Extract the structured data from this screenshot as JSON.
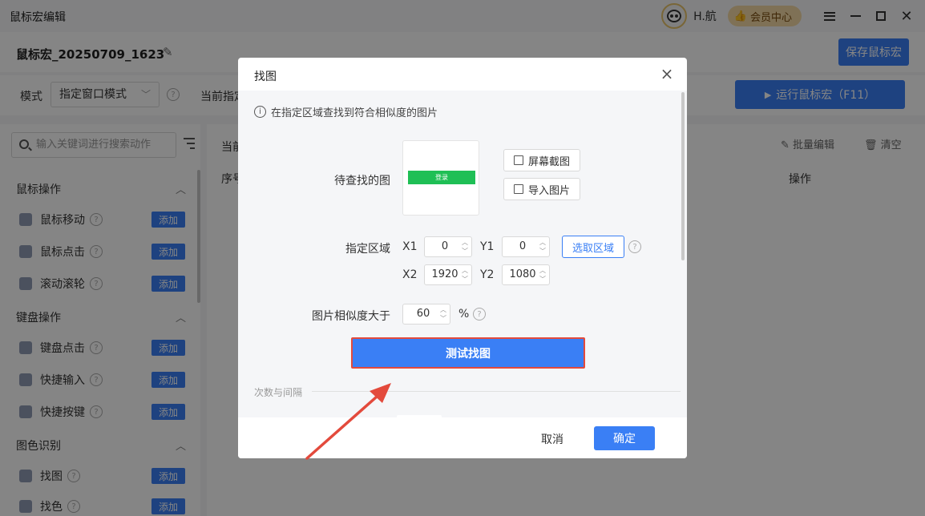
{
  "app": {
    "title": "鼠标宏编辑",
    "user_name": "H.航",
    "vip_label": "会员中心"
  },
  "header": {
    "macro_name": "鼠标宏_20250709_1623",
    "save_label": "保存鼠标宏"
  },
  "toolbar": {
    "mode_label": "模式",
    "mode_value": "指定窗口模式",
    "current_label": "当前指定",
    "run_label": "运行鼠标宏（F11）"
  },
  "sidebar": {
    "search_placeholder": "输入关键词进行搜索动作",
    "add_label": "添加",
    "categories": [
      {
        "title": "鼠标操作",
        "items": [
          "鼠标移动",
          "鼠标点击",
          "滚动滚轮"
        ]
      },
      {
        "title": "键盘操作",
        "items": [
          "键盘点击",
          "快捷输入",
          "快捷按键"
        ]
      },
      {
        "title": "图色识别",
        "items": [
          "找图",
          "找色"
        ]
      }
    ]
  },
  "main": {
    "current_step_label": "当前",
    "batch_edit": "批量编辑",
    "clear": "清空",
    "col_seq": "序号",
    "col_op": "操作"
  },
  "dialog": {
    "title": "找图",
    "info": "在指定区域查找到符合相似度的图片",
    "target_label": "待查找的图",
    "thumb_text": "登录",
    "screenshot_btn": "屏幕截图",
    "import_btn": "导入图片",
    "region_label": "指定区域",
    "x1_label": "X1",
    "x1": "0",
    "y1_label": "Y1",
    "y1": "0",
    "x2_label": "X2",
    "x2": "1920",
    "y2_label": "Y2",
    "y2": "1080",
    "pick_region": "选取区域",
    "similarity_label": "图片相似度大于",
    "similarity": "60",
    "percent": "%",
    "test_btn": "测试找图",
    "section": "次数与间隔",
    "cancel": "取消",
    "ok": "确定"
  },
  "colors": {
    "accent": "#3a7ff5",
    "highlight": "#e34a3c",
    "vip": "#f3d9a6"
  }
}
